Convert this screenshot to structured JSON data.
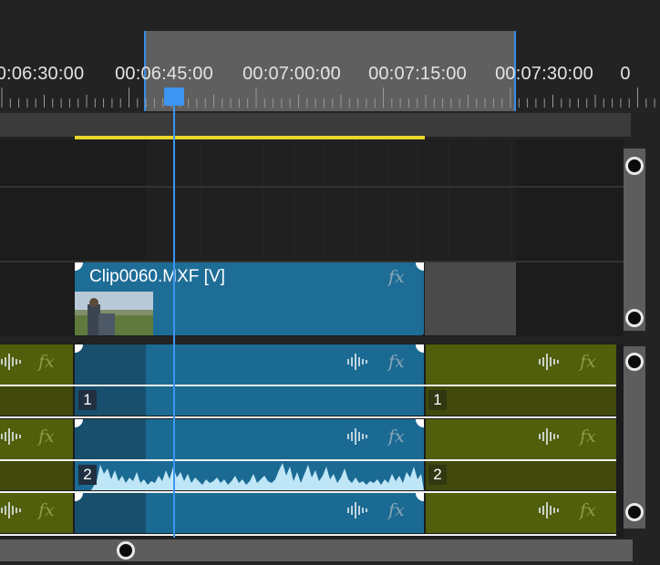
{
  "ruler": {
    "timecodes": [
      "0:06:30:00",
      "00:06:45:00",
      "00:07:00:00",
      "00:07:15:00",
      "00:07:30:00",
      "0"
    ]
  },
  "video_track": {
    "clip_name": "Clip0060.MXF [V]",
    "fx_label": "fx"
  },
  "audio_tracks": [
    {
      "label": "1",
      "fx_label": "fx"
    },
    {
      "label": "2",
      "fx_label": "fx"
    },
    {
      "fx_label": "fx"
    }
  ],
  "colors": {
    "video_clip": "#1e6d97",
    "audio_clip_olive": "#515e0b",
    "playhead": "#3c95f0",
    "work_area": "#e9d62c"
  }
}
